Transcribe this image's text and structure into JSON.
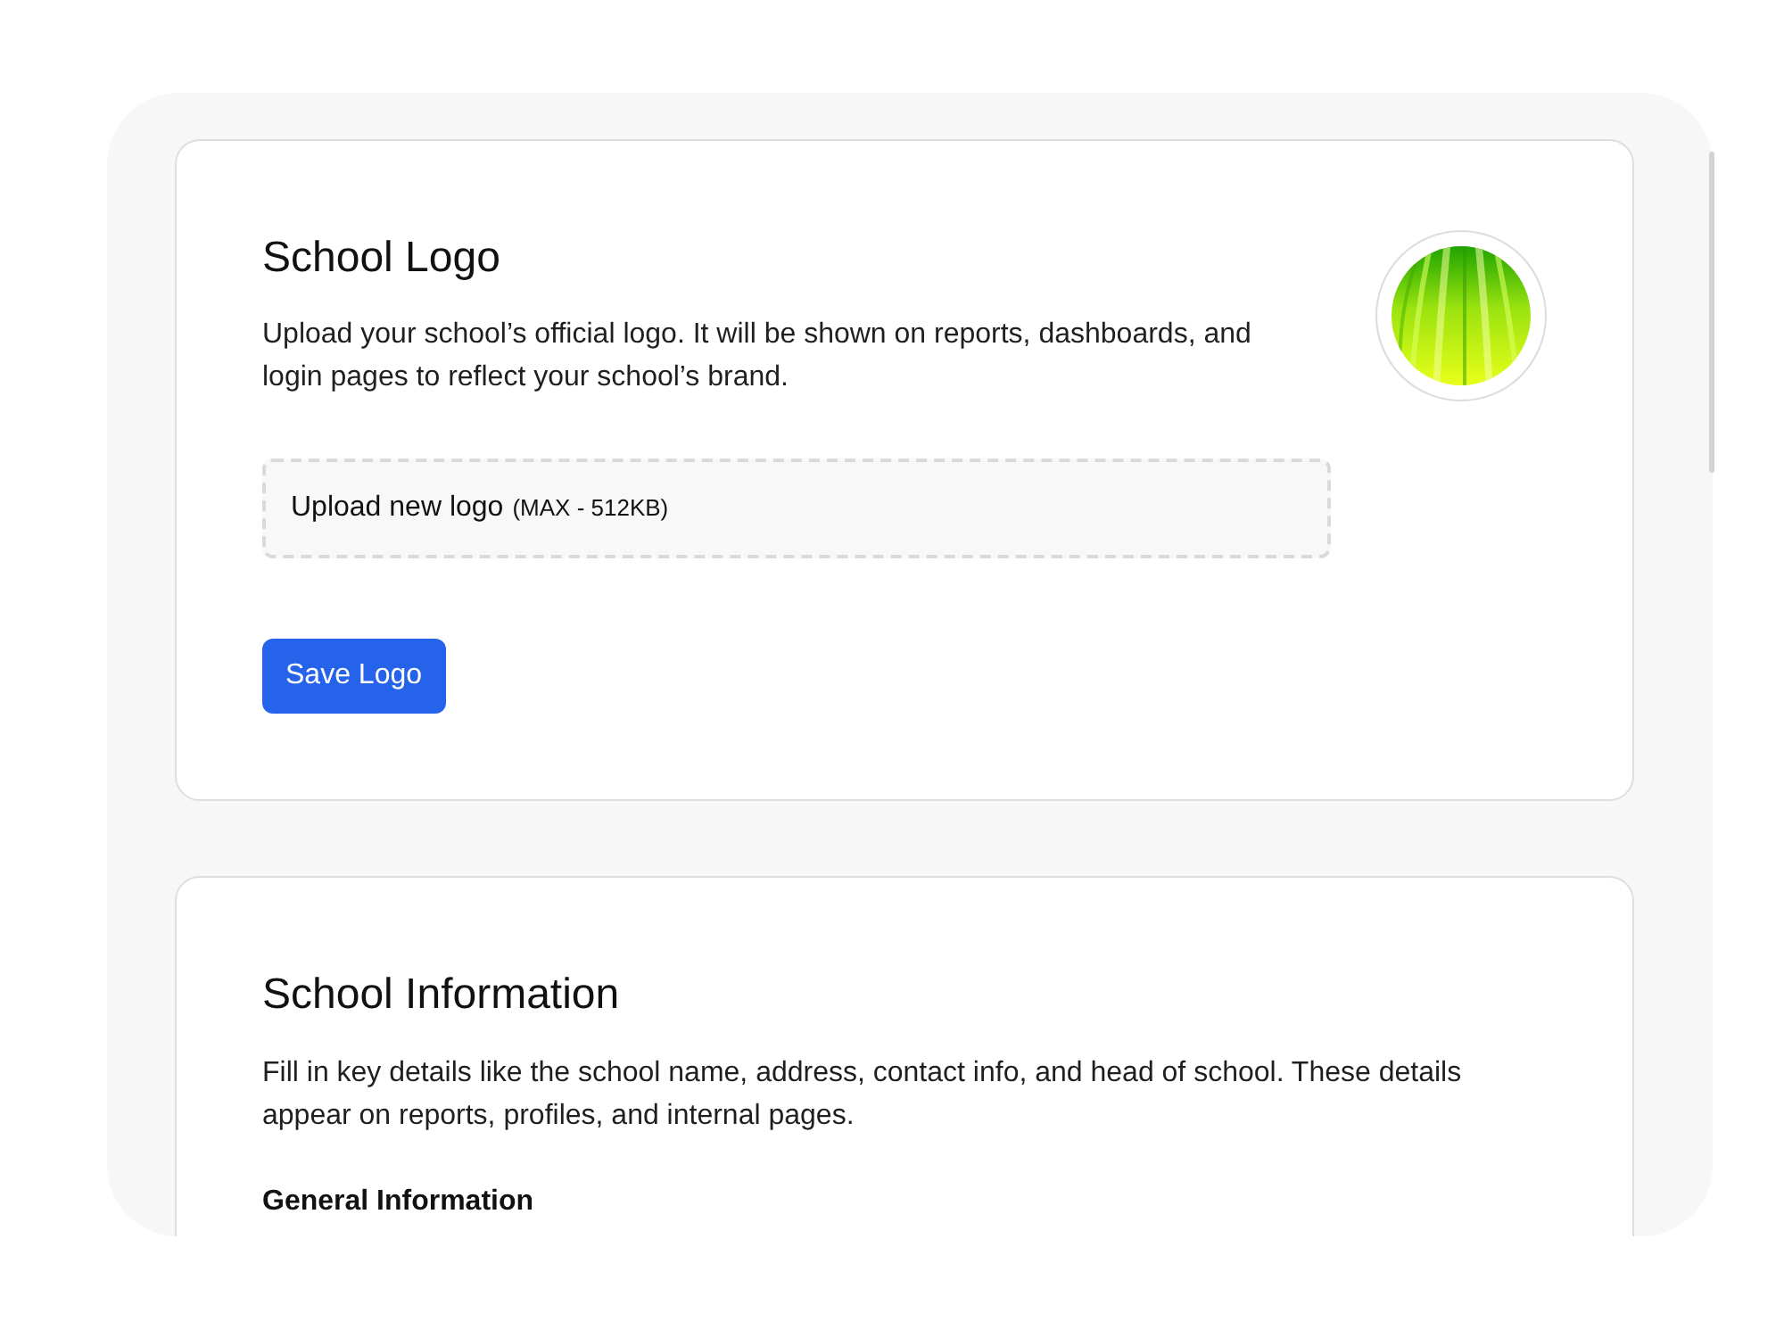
{
  "sections": [
    {
      "kind": "logo",
      "title": "School Logo",
      "description": "Upload your school’s official logo. It will be shown on reports, dashboards, and login pages to reflect your school’s brand.",
      "upload": {
        "label": "Upload new logo",
        "hint": "(MAX - 512KB)"
      },
      "button": "Save Logo"
    },
    {
      "kind": "info",
      "title": "School Information",
      "description": "Fill in key details like the school name, address, contact info, and head of school. These details appear on reports, profiles, and internal pages.",
      "subheading": "General Information"
    }
  ]
}
